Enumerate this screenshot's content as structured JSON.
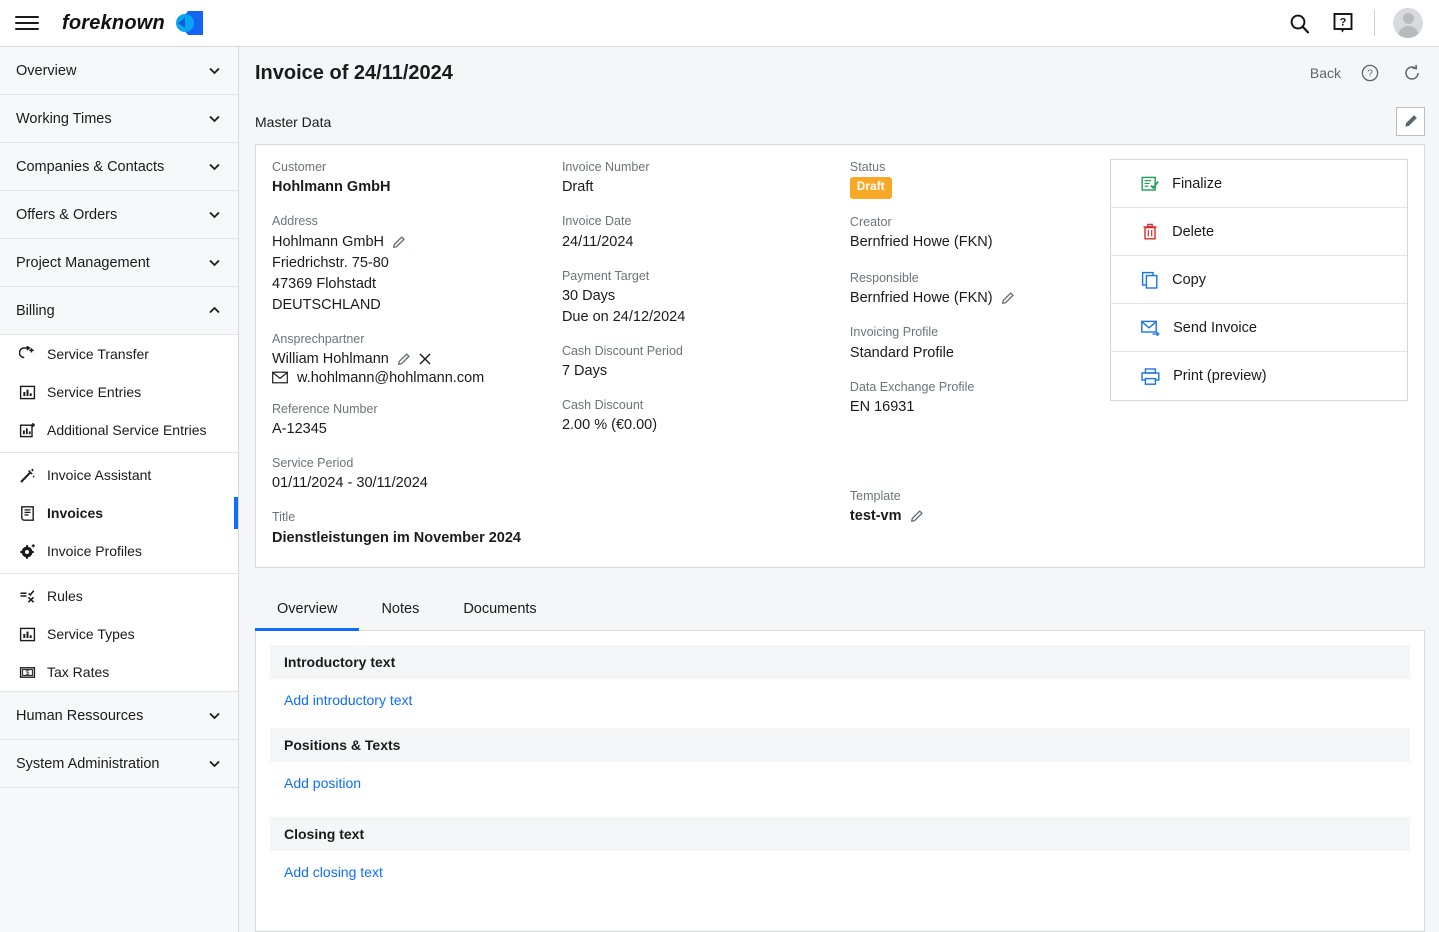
{
  "topbar": {
    "brand_name": "foreknown",
    "menu_icon": "hamburger-icon",
    "search_icon": "search-icon",
    "help_icon": "help-icon",
    "avatar_icon": "user-avatar"
  },
  "sidebar": {
    "groups": [
      {
        "label": "Overview",
        "expanded": false
      },
      {
        "label": "Working Times",
        "expanded": false
      },
      {
        "label": "Companies & Contacts",
        "expanded": false
      },
      {
        "label": "Offers & Orders",
        "expanded": false
      },
      {
        "label": "Project Management",
        "expanded": false
      },
      {
        "label": "Billing",
        "expanded": true
      },
      {
        "label": "Human Ressources",
        "expanded": false
      },
      {
        "label": "System Administration",
        "expanded": false
      }
    ],
    "billing_items": [
      {
        "label": "Service Transfer",
        "icon": "service-transfer-icon",
        "active": false
      },
      {
        "label": "Service Entries",
        "icon": "bar-chart-icon",
        "active": false
      },
      {
        "label": "Additional Service Entries",
        "icon": "bar-chart-plus-icon",
        "active": false
      },
      {
        "label": "Invoice Assistant",
        "icon": "magic-wand-icon",
        "active": false
      },
      {
        "label": "Invoices",
        "icon": "invoice-icon",
        "active": true
      },
      {
        "label": "Invoice Profiles",
        "icon": "gear-plus-icon",
        "active": false
      },
      {
        "label": "Rules",
        "icon": "rules-icon",
        "active": false
      },
      {
        "label": "Service Types",
        "icon": "bar-chart-icon",
        "active": false
      },
      {
        "label": "Tax Rates",
        "icon": "money-icon",
        "active": false
      }
    ]
  },
  "page": {
    "title": "Invoice of 24/11/2024",
    "back_label": "Back",
    "help_icon": "circle-question-icon",
    "refresh_icon": "refresh-icon",
    "section_label": "Master Data",
    "edit_icon": "pencil-icon"
  },
  "master_data": {
    "customer": {
      "label": "Customer",
      "value": "Hohlmann GmbH"
    },
    "address": {
      "label": "Address",
      "lines": [
        "Hohlmann GmbH",
        "Friedrichstr. 75-80",
        "47369 Flohstadt",
        "DEUTSCHLAND"
      ]
    },
    "contact": {
      "label": "Ansprechpartner",
      "name": "William Hohlmann",
      "email": "w.hohlmann@hohlmann.com"
    },
    "reference_number": {
      "label": "Reference Number",
      "value": "A-12345"
    },
    "service_period": {
      "label": "Service Period",
      "value": "01/11/2024 - 30/11/2024"
    },
    "title": {
      "label": "Title",
      "value": "Dienstleistungen im November 2024"
    },
    "invoice_number": {
      "label": "Invoice Number",
      "value": "Draft"
    },
    "invoice_date": {
      "label": "Invoice Date",
      "value": "24/11/2024"
    },
    "payment_target": {
      "label": "Payment Target",
      "value": "30  Days",
      "due": "Due on 24/12/2024"
    },
    "cash_discount_period": {
      "label": "Cash Discount Period",
      "value": "7  Days"
    },
    "cash_discount": {
      "label": "Cash Discount",
      "value": "2.00 %  (€0.00)"
    },
    "status": {
      "label": "Status",
      "value": "Draft",
      "color": "#f7a827"
    },
    "creator": {
      "label": "Creator",
      "value": "Bernfried Howe (FKN)"
    },
    "responsible": {
      "label": "Responsible",
      "value": "Bernfried Howe (FKN)"
    },
    "invoicing_profile": {
      "label": "Invoicing Profile",
      "value": "Standard Profile"
    },
    "data_exchange_profile": {
      "label": "Data Exchange Profile",
      "value": "EN 16931"
    },
    "template": {
      "label": "Template",
      "value": "test-vm"
    }
  },
  "actions": [
    {
      "label": "Finalize",
      "icon": "finalize-icon",
      "color": "#1e9e57"
    },
    {
      "label": "Delete",
      "icon": "trash-icon",
      "color": "#e02b2b"
    },
    {
      "label": "Copy",
      "icon": "copy-icon",
      "color": "#1a73e8"
    },
    {
      "label": "Send Invoice",
      "icon": "send-mail-icon",
      "color": "#1a73e8"
    },
    {
      "label": "Print (preview)",
      "icon": "printer-icon",
      "color": "#1a73e8"
    }
  ],
  "tabs": [
    {
      "label": "Overview",
      "active": true
    },
    {
      "label": "Notes",
      "active": false
    },
    {
      "label": "Documents",
      "active": false
    }
  ],
  "sections": [
    {
      "heading": "Introductory text",
      "link": "Add introductory text"
    },
    {
      "heading": "Positions & Texts",
      "link": "Add position"
    },
    {
      "heading": "Closing text",
      "link": "Add closing text"
    }
  ]
}
